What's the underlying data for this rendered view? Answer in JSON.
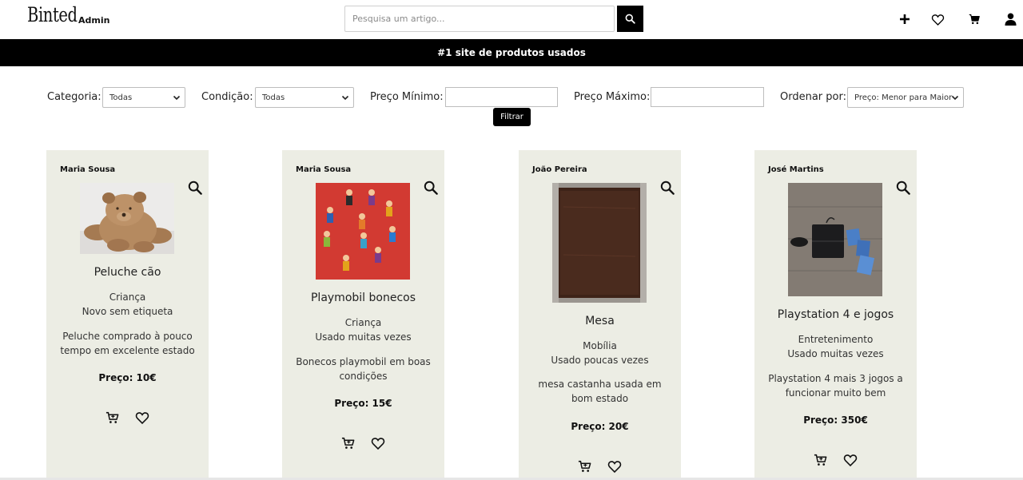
{
  "header": {
    "logo": "Binted",
    "admin_label": "Admin",
    "search_placeholder": "Pesquisa um artigo...",
    "icons": [
      "search-icon",
      "plus-icon",
      "heart-icon",
      "cart-icon",
      "user-icon"
    ]
  },
  "banner": {
    "text": "#1 site de produtos usados"
  },
  "filters": {
    "category_label": "Categoria:",
    "category_value": "Todas",
    "condition_label": "Condição:",
    "condition_value": "Todas",
    "min_price_label": "Preço Mínimo:",
    "min_price_value": "",
    "max_price_label": "Preço Máximo:",
    "max_price_value": "",
    "sort_label": "Ordenar por:",
    "sort_value": "Preço: Menor para Maior",
    "filter_button": "Filtrar"
  },
  "products": [
    {
      "seller": "Maria Sousa",
      "title": "Peluche cão",
      "category": "Criança",
      "condition": "Novo sem etiqueta",
      "description": "Peluche comprado à pouco tempo em excelente estado",
      "price": "Preço: 10€"
    },
    {
      "seller": "Maria Sousa",
      "title": "Playmobil bonecos",
      "category": "Criança",
      "condition": "Usado muitas vezes",
      "description": "Bonecos playmobil em boas condições",
      "price": "Preço: 15€"
    },
    {
      "seller": "João Pereira",
      "title": "Mesa",
      "category": "Mobília",
      "condition": "Usado poucas vezes",
      "description": "mesa castanha usada em bom estado",
      "price": "Preço: 20€"
    },
    {
      "seller": "José Martins",
      "title": "Playstation 4 e jogos",
      "category": "Entretenimento",
      "condition": "Usado muitas vezes",
      "description": "Playstation 4 mais 3 jogos a funcionar muito bem",
      "price": "Preço: 350€"
    }
  ],
  "colors": {
    "card_bg": "#ecede4",
    "banner_bg": "#000000",
    "accent": "#000000"
  }
}
